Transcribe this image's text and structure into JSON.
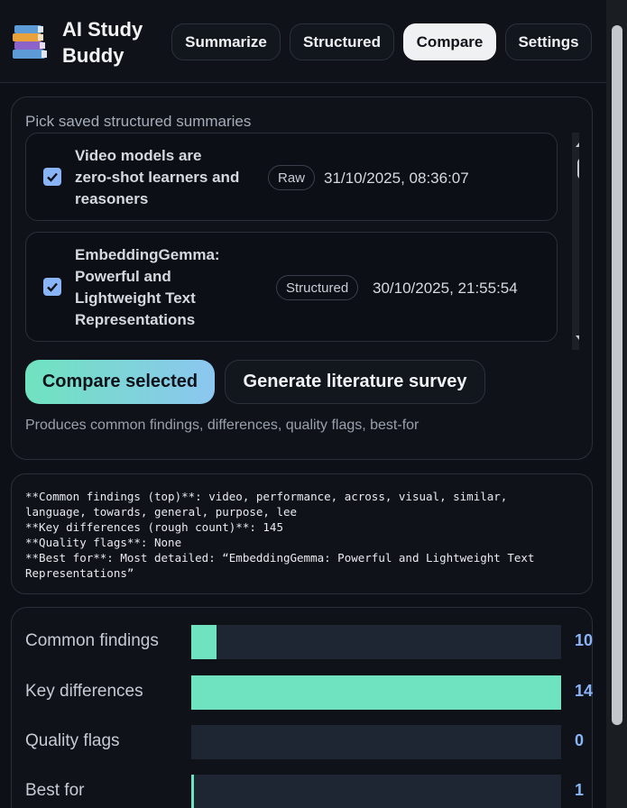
{
  "app": {
    "title": "AI Study Buddy",
    "logo_icon": "books-icon"
  },
  "tabs": [
    {
      "label": "Summarize",
      "active": false
    },
    {
      "label": "Structured",
      "active": false
    },
    {
      "label": "Compare",
      "active": true
    },
    {
      "label": "Settings",
      "active": false
    }
  ],
  "picker": {
    "label": "Pick saved structured summaries",
    "items": [
      {
        "title": "Video models are zero-shot learners and reasoners",
        "badge": "Raw",
        "date": "31/10/2025, 08:36:07",
        "checked": true
      },
      {
        "title": "EmbeddingGemma: Powerful and Lightweight Text Representations",
        "badge": "Structured",
        "date": "30/10/2025, 21:55:54",
        "checked": true
      }
    ]
  },
  "actions": {
    "compare_label": "Compare selected",
    "survey_label": "Generate literature survey",
    "hint": "Produces common findings, differences, quality flags, best-for"
  },
  "output": {
    "text": "**Common findings (top)**: video, performance, across, visual, similar,\nlanguage, towards, general, purpose, lee\n**Key differences (rough count)**: 145\n**Quality flags**: None\n**Best for**: Most detailed: “EmbeddingGemma: Powerful and Lightweight Text\nRepresentations”"
  },
  "chart_data": {
    "type": "bar",
    "orientation": "horizontal",
    "categories": [
      "Common findings",
      "Key differences",
      "Quality flags",
      "Best for"
    ],
    "values": [
      10,
      145,
      0,
      1
    ],
    "value_labels": [
      "10",
      "14",
      "0",
      "1"
    ],
    "xlim": [
      0,
      145
    ],
    "bar_color": "#6fe3bf",
    "track_color": "#1e2633",
    "value_color": "#8ab4f8"
  }
}
